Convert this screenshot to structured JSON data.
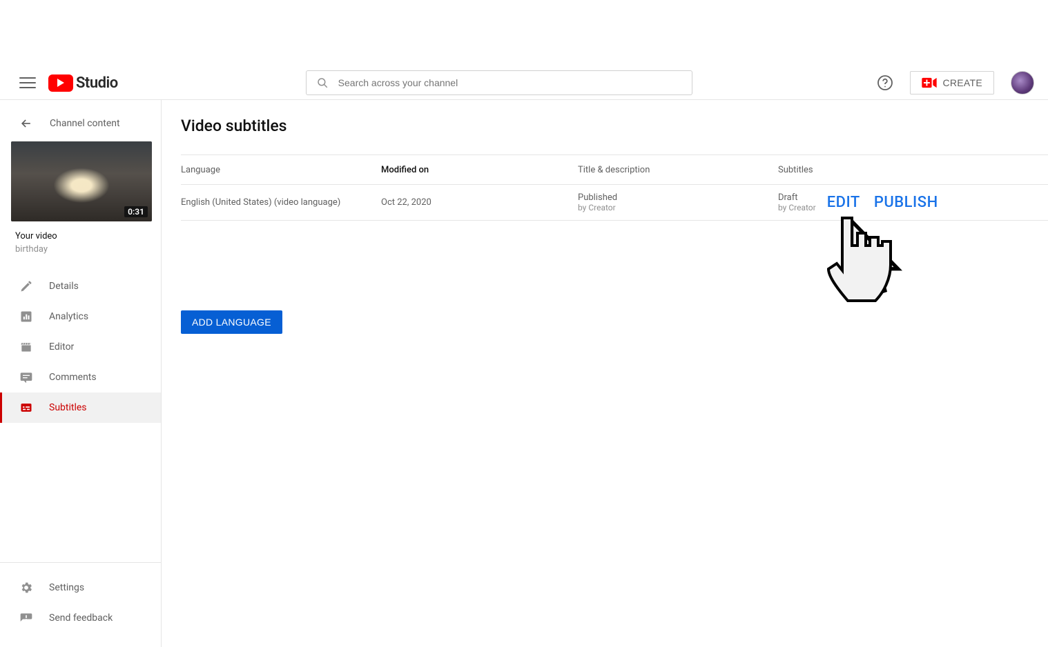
{
  "header": {
    "logo_text": "Studio",
    "search_placeholder": "Search across your channel",
    "create_label": "CREATE"
  },
  "sidebar": {
    "back_label": "Channel content",
    "video_label": "Your video",
    "video_name": "birthday",
    "video_duration": "0:31",
    "nav": [
      {
        "key": "details",
        "label": "Details"
      },
      {
        "key": "analytics",
        "label": "Analytics"
      },
      {
        "key": "editor",
        "label": "Editor"
      },
      {
        "key": "comments",
        "label": "Comments"
      },
      {
        "key": "subtitles",
        "label": "Subtitles"
      }
    ],
    "footer": [
      {
        "key": "settings",
        "label": "Settings"
      },
      {
        "key": "feedback",
        "label": "Send feedback"
      }
    ]
  },
  "main": {
    "page_title": "Video subtitles",
    "columns": {
      "language": "Language",
      "modified": "Modified on",
      "title_desc": "Title & description",
      "subtitles": "Subtitles"
    },
    "row": {
      "language": "English (United States) (video language)",
      "modified": "Oct 22, 2020",
      "title_status": "Published",
      "title_by": "by Creator",
      "subtitle_status": "Draft",
      "subtitle_by": "by Creator"
    },
    "edit_label": "EDIT",
    "publish_label": "PUBLISH",
    "add_language_label": "ADD LANGUAGE"
  }
}
